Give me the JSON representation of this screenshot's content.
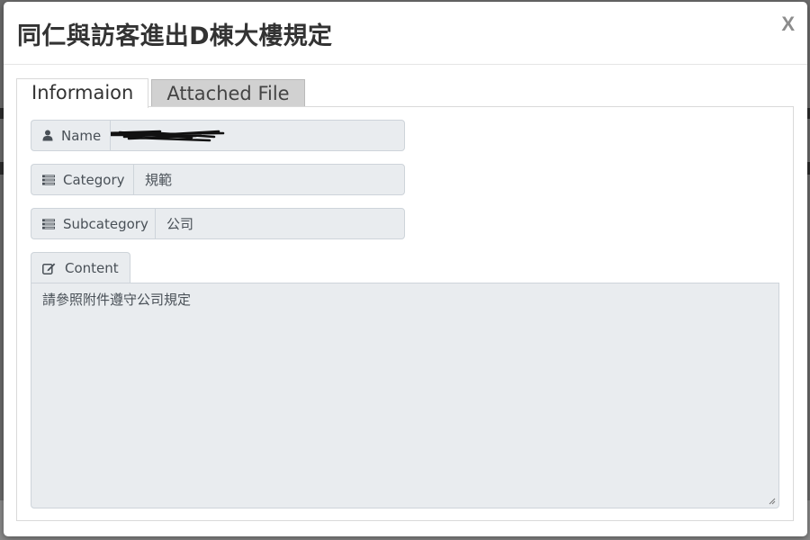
{
  "modal": {
    "title": "同仁與訪客進出D棟大樓規定",
    "close_label": "X"
  },
  "tabs": [
    {
      "label": "Informaion",
      "active": true
    },
    {
      "label": "Attached File",
      "active": false
    }
  ],
  "fields": {
    "name": {
      "label": "Name",
      "icon": "user-icon",
      "value": ""
    },
    "category": {
      "label": "Category",
      "icon": "list-icon",
      "value": "規範"
    },
    "subcategory": {
      "label": "Subcategory",
      "icon": "list-icon",
      "value": "公司"
    },
    "content": {
      "label": "Content",
      "icon": "edit-icon",
      "value": "請參照附件遵守公司規定"
    }
  },
  "colors": {
    "addon_bg": "#e9ecef",
    "border": "#ced4da",
    "inactive_tab_bg": "#d1d1d1",
    "title_text": "#333333"
  }
}
